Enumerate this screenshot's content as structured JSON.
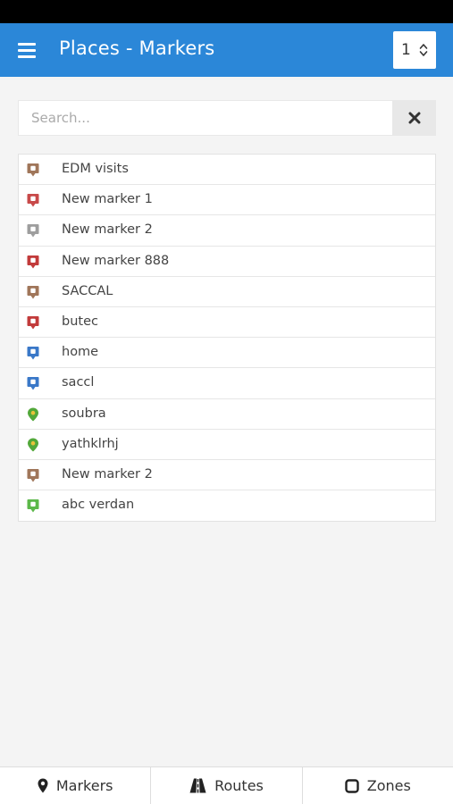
{
  "header": {
    "title": "Places - Markers",
    "page_select_value": "1",
    "menu_icon": "hamburger-icon",
    "select_icon": "updown-chevron-icon"
  },
  "search": {
    "placeholder": "Search...",
    "value": "",
    "clear_icon": "close-icon"
  },
  "markers": [
    {
      "label": "EDM visits",
      "color": "#a0765a",
      "icon": "marker-pin-icon"
    },
    {
      "label": "New marker 1",
      "color": "#c84a4a",
      "icon": "marker-pin-icon"
    },
    {
      "label": "New marker 2",
      "color": "#9e9e9e",
      "icon": "marker-pin-icon"
    },
    {
      "label": "New marker 888",
      "color": "#c23b3b",
      "icon": "marker-pin-icon"
    },
    {
      "label": "SACCAL",
      "color": "#a0765a",
      "icon": "marker-pin-icon"
    },
    {
      "label": "butec",
      "color": "#c23b3b",
      "icon": "marker-pin-icon"
    },
    {
      "label": "home",
      "color": "#3a78c8",
      "icon": "marker-pin-icon"
    },
    {
      "label": "saccl",
      "color": "#3a78c8",
      "icon": "marker-pin-icon"
    },
    {
      "label": "soubra",
      "color": "#52a83a",
      "icon": "map-pin-icon"
    },
    {
      "label": "yathklrhj",
      "color": "#52a83a",
      "icon": "map-pin-icon"
    },
    {
      "label": "New marker 2",
      "color": "#a0765a",
      "icon": "marker-pin-icon"
    },
    {
      "label": "abc verdan",
      "color": "#5cb84a",
      "icon": "marker-pin-icon"
    }
  ],
  "tabs": [
    {
      "label": "Markers",
      "icon": "map-marker-icon"
    },
    {
      "label": "Routes",
      "icon": "road-icon"
    },
    {
      "label": "Zones",
      "icon": "square-outline-icon"
    }
  ],
  "colors": {
    "header_bg": "#2b87d8",
    "page_bg": "#f4f4f4",
    "status_bar": "#000000"
  }
}
